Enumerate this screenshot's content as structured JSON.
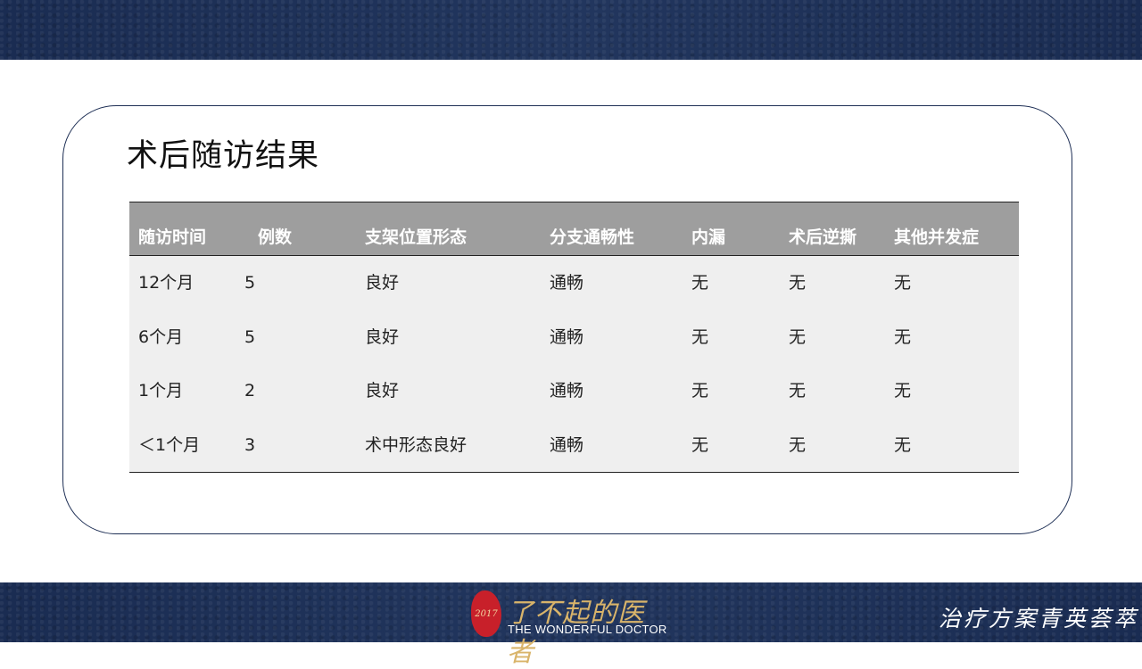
{
  "title": "术后随访结果",
  "table": {
    "headers": [
      "随访时间",
      "例数",
      "支架位置形态",
      "分支通畅性",
      "内漏",
      "术后逆撕",
      "其他并发症"
    ],
    "rows": [
      [
        "12个月",
        "5",
        "良好",
        "通畅",
        "无",
        "无",
        "无"
      ],
      [
        "6个月",
        "5",
        "良好",
        "通畅",
        "无",
        "无",
        "无"
      ],
      [
        "1个月",
        "2",
        "良好",
        "通畅",
        "无",
        "无",
        "无"
      ],
      [
        "＜1个月",
        "3",
        "术中形态良好",
        "通畅",
        "无",
        "无",
        "无"
      ]
    ]
  },
  "footer": {
    "seal_text": "2017",
    "logo_cn": "了不起的医者",
    "logo_en": "THE WONDERFUL DOCTOR",
    "slogan": "治疗方案青英荟萃"
  },
  "colors": {
    "band": "#1c2f55",
    "header_bg": "#9e9e9e",
    "body_bg": "#efefef",
    "gold": "#d9b46a",
    "seal_red": "#c8202a"
  }
}
